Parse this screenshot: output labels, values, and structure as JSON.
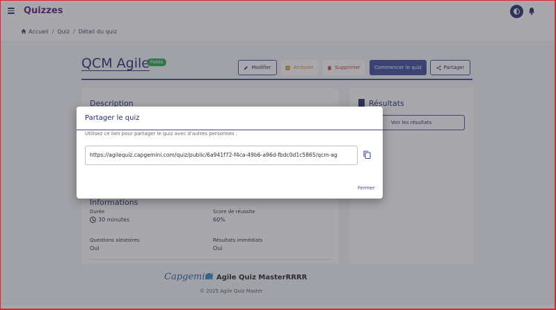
{
  "app": {
    "title": "Quizzes"
  },
  "breadcrumb": {
    "items": [
      "Accueil",
      "Quiz",
      "Détail du quiz"
    ],
    "separator": "/"
  },
  "quiz": {
    "title": "QCM Agile",
    "status_badge": "Publié"
  },
  "actions": {
    "modify": "Modifier",
    "archive": "Archiver",
    "delete": "Supprimer",
    "start": "Commencer le quiz",
    "share": "Partager"
  },
  "description": {
    "heading": "Description"
  },
  "results": {
    "heading": "Résultats",
    "button": "Voir les résultats"
  },
  "info": {
    "heading": "Informations",
    "duration_label": "Durée",
    "duration_value": "30 minutes",
    "score_label": "Score de réussite",
    "score_value": "60%",
    "random_label": "Questions aléatoires",
    "random_value": "Oui",
    "immediate_label": "Résultats immédiats",
    "immediate_value": "Oui"
  },
  "footer": {
    "logo": "Capgemini",
    "product": "Agile Quiz MasterRRRR",
    "copyright": "© 2025 Agile Quiz Master"
  },
  "modal": {
    "title": "Partager le quiz",
    "description": "Utilisez ce lien pour partager le quiz avec d'autres personnes :",
    "link": "https://agilequiz.capgemini.com/quiz/public/6a941f72-f4ca-49b6-a96d-fbdc0d1c5865/qcm-ag",
    "close": "Fermer"
  },
  "icons": [
    "menu-icon",
    "theme-toggle-icon",
    "bell-icon",
    "home-icon",
    "edit-icon",
    "archive-icon",
    "trash-icon",
    "share-icon",
    "clipboard-icon",
    "clock-icon",
    "copy-icon"
  ],
  "colors": {
    "primary": "#3b4a9c",
    "title": "#1f2a6b",
    "brand": "#5b1a7a",
    "success": "#29a84e",
    "warning": "#d7891a",
    "danger": "#d1312b"
  }
}
